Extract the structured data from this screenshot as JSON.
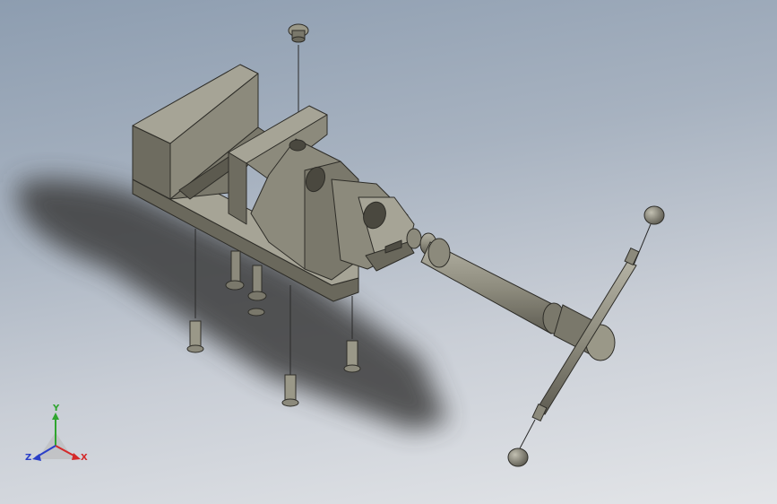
{
  "triad": {
    "x_label": "X",
    "y_label": "Y",
    "z_label": "Z",
    "x_color": "#d42a2a",
    "y_color": "#2fa52f",
    "z_color": "#2a3fc8"
  },
  "model": {
    "part_color": "#8c8a7c",
    "part_shade_color": "#6a685c",
    "part_light_color": "#a6a496",
    "explode_line_color": "#2a2a2a",
    "icons": [
      "vise-body-icon",
      "movable-jaw-icon",
      "lead-screw-icon",
      "handle-bar-icon",
      "screw-icon",
      "ball-knob-icon"
    ]
  }
}
